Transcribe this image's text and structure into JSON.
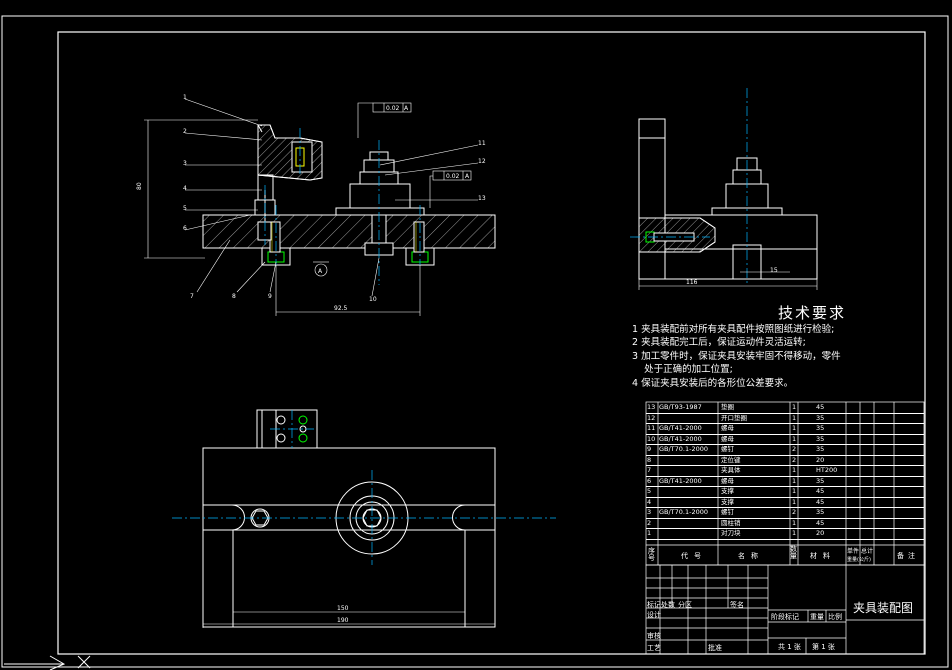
{
  "drawing_title": "夹具装配图",
  "tech_requirements": {
    "title": "技术要求",
    "items": [
      "1  夹具装配前对所有夹具配件按照图纸进行检验;",
      "2  夹具装配完工后，保证运动件灵活运转;",
      "3  加工零件时，保证夹具安装牢固不得移动，零件",
      "    处于正确的加工位置;",
      "4  保证夹具安装后的各形位公差要求。"
    ]
  },
  "bom": {
    "rows": [
      {
        "no": "13",
        "code": "GB/T93-1987",
        "name": "垫圈",
        "qty": "1",
        "material": "45"
      },
      {
        "no": "12",
        "code": "",
        "name": "开口垫圈",
        "qty": "1",
        "material": "35"
      },
      {
        "no": "11",
        "code": "GB/T41-2000",
        "name": "螺母",
        "qty": "1",
        "material": "35"
      },
      {
        "no": "10",
        "code": "GB/T41-2000",
        "name": "螺母",
        "qty": "1",
        "material": "35"
      },
      {
        "no": "9",
        "code": "GB/T70.1-2000",
        "name": "螺钉",
        "qty": "2",
        "material": "35"
      },
      {
        "no": "8",
        "code": "",
        "name": "定位键",
        "qty": "2",
        "material": "20"
      },
      {
        "no": "7",
        "code": "",
        "name": "夹具体",
        "qty": "1",
        "material": "HT200"
      },
      {
        "no": "6",
        "code": "GB/T41-2000",
        "name": "螺母",
        "qty": "1",
        "material": "35"
      },
      {
        "no": "5",
        "code": "",
        "name": "支撑",
        "qty": "1",
        "material": "45"
      },
      {
        "no": "4",
        "code": "",
        "name": "支撑",
        "qty": "1",
        "material": "45"
      },
      {
        "no": "3",
        "code": "GB/T70.1-2000",
        "name": "螺钉",
        "qty": "2",
        "material": "35"
      },
      {
        "no": "2",
        "code": "",
        "name": "圆柱销",
        "qty": "1",
        "material": "45"
      },
      {
        "no": "1",
        "code": "",
        "name": "对刀块",
        "qty": "1",
        "material": "20"
      }
    ],
    "header": {
      "no": "序号",
      "code": "代号",
      "name": "名称",
      "qty": "数量",
      "material": "材料",
      "single": "单件",
      "total": "总计",
      "weight": "重量(公斤)",
      "remark": "备注"
    }
  },
  "title_block": {
    "mark": "标记",
    "count": "处数",
    "zone": "分区",
    "sign": "签名",
    "design": "设计",
    "review": "审核",
    "process": "工艺",
    "approve": "批准",
    "stage_mark": "阶段标记",
    "weight": "重量",
    "scale": "比例",
    "sheets": "共 1 张",
    "sheet_no": "第 1 张"
  },
  "dimensions": {
    "d_80": "80",
    "d_92_5": "92.5",
    "d_150": "150",
    "d_190": "190",
    "d_116": "116",
    "d_15": "15",
    "tol_1": "0.02",
    "tol_2": "0.02",
    "datum": "A"
  },
  "balloons": [
    "1",
    "2",
    "3",
    "4",
    "5",
    "6",
    "7",
    "8",
    "9",
    "10",
    "11",
    "12",
    "13"
  ],
  "colors": {
    "background": "#000000",
    "line": "#ffffff",
    "centerline": "#00b4ff",
    "green": "#00ff00",
    "yellow": "#ffff00"
  }
}
